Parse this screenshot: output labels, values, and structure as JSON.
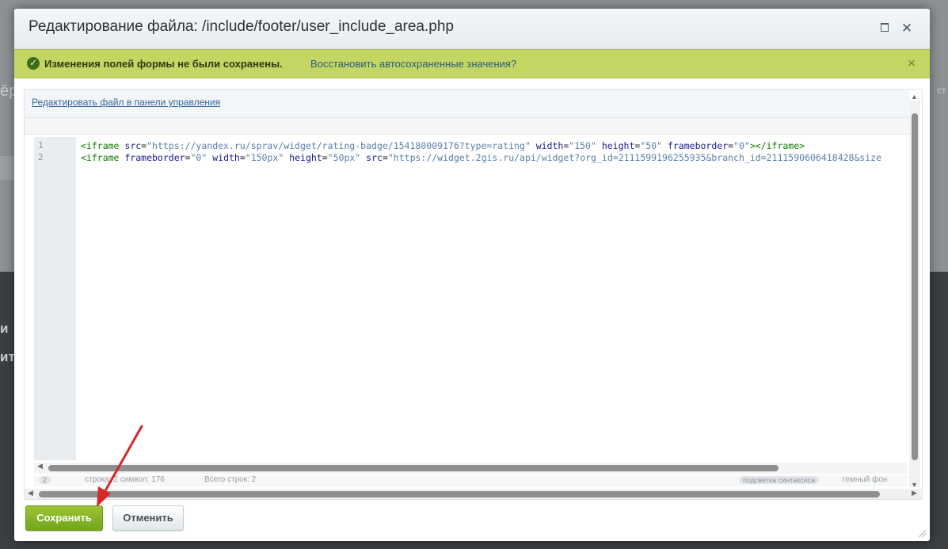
{
  "background": {
    "fragments": [
      "ёр",
      "ст",
      "и",
      "ит"
    ]
  },
  "dialog": {
    "title": "Редактирование файла: /include/footer/user_include_area.php",
    "expand_icon": "maximize-icon",
    "close_icon": "close-icon"
  },
  "notice": {
    "message": "Изменения полей формы не были сохранены.",
    "restore_link": "Восстановить автосохраненные значения?",
    "icon": "checkmark-icon",
    "close_symbol": "×",
    "color": "#c3d563"
  },
  "editor": {
    "panel_link": "Редактировать файл в панели управления",
    "line_numbers": [
      "1",
      "2"
    ],
    "lines": [
      [
        {
          "t": "tag",
          "v": "<iframe "
        },
        {
          "t": "attr",
          "v": "src"
        },
        {
          "t": "plain",
          "v": "="
        },
        {
          "t": "str",
          "v": "\"https://yandex.ru/sprav/widget/rating-badge/154180009176?type=rating\""
        },
        {
          "t": "plain",
          "v": " "
        },
        {
          "t": "attr",
          "v": "width"
        },
        {
          "t": "plain",
          "v": "="
        },
        {
          "t": "str",
          "v": "\"150\""
        },
        {
          "t": "plain",
          "v": " "
        },
        {
          "t": "attr",
          "v": "height"
        },
        {
          "t": "plain",
          "v": "="
        },
        {
          "t": "str",
          "v": "\"50\""
        },
        {
          "t": "plain",
          "v": " "
        },
        {
          "t": "attr",
          "v": "frameborder"
        },
        {
          "t": "plain",
          "v": "="
        },
        {
          "t": "str",
          "v": "\"0\""
        },
        {
          "t": "tag",
          "v": "></iframe>"
        }
      ],
      [
        {
          "t": "tag",
          "v": "<iframe "
        },
        {
          "t": "attr",
          "v": "frameborder"
        },
        {
          "t": "plain",
          "v": "="
        },
        {
          "t": "str",
          "v": "\"0\""
        },
        {
          "t": "plain",
          "v": " "
        },
        {
          "t": "attr",
          "v": "width"
        },
        {
          "t": "plain",
          "v": "="
        },
        {
          "t": "str",
          "v": "\"150px\""
        },
        {
          "t": "plain",
          "v": " "
        },
        {
          "t": "attr",
          "v": "height"
        },
        {
          "t": "plain",
          "v": "="
        },
        {
          "t": "str",
          "v": "\"50px\""
        },
        {
          "t": "plain",
          "v": " "
        },
        {
          "t": "attr",
          "v": "src"
        },
        {
          "t": "plain",
          "v": "="
        },
        {
          "t": "str",
          "v": "\"https://widget.2gis.ru/api/widget?org_id=2111599196255935&branch_id=2111590606418428&size"
        }
      ]
    ],
    "status": {
      "line_no": "2",
      "position": "строка: 2    символ: 176",
      "total": "Всего строк: 2",
      "highlight_toggle": "подсветка синтаксиса",
      "theme": "темный фон"
    }
  },
  "buttons": {
    "save": "Сохранить",
    "cancel": "Отменить"
  },
  "colors": {
    "save_button": "#7cad22",
    "annotation_arrow": "#d62828",
    "link": "#2f66a0"
  }
}
